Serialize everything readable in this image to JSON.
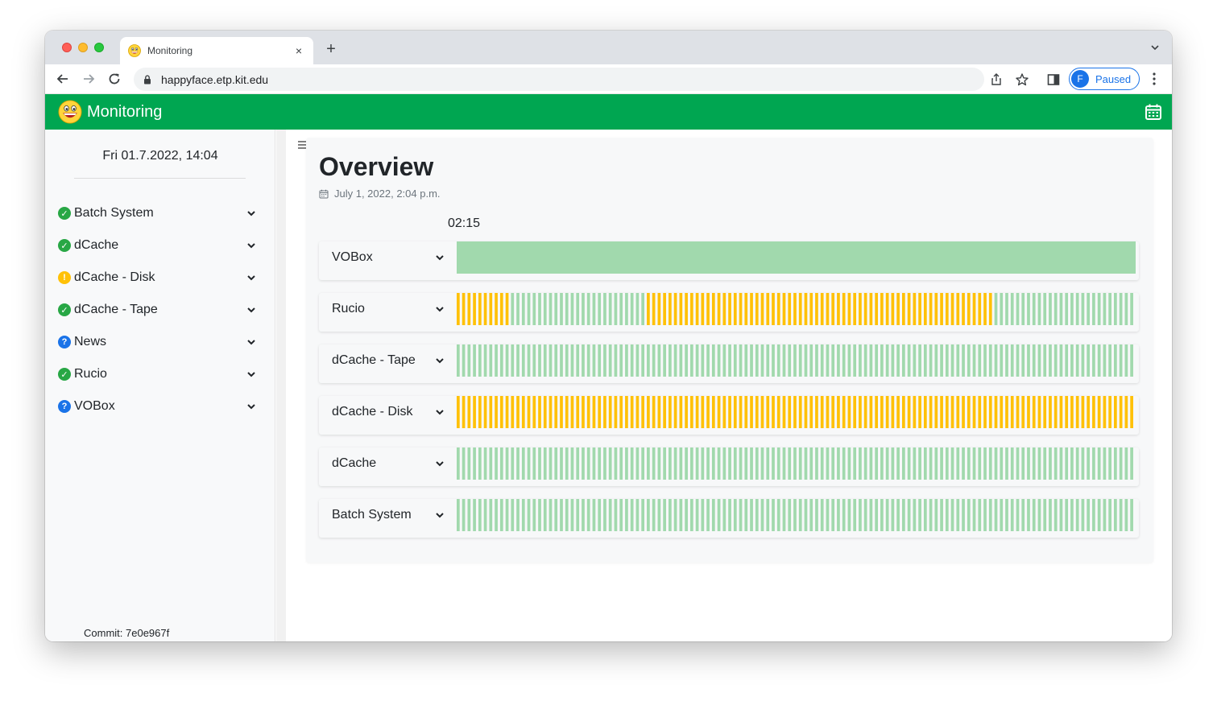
{
  "browser": {
    "tab_title": "Monitoring",
    "tab_close": "×",
    "new_tab": "+",
    "url": "happyface.etp.kit.edu",
    "profile_initial": "F",
    "profile_label": "Paused"
  },
  "navbar": {
    "brand": "Monitoring",
    "logo_icon": "happy-face-icon",
    "right_icon": "calendar-icon",
    "color": "#00a651"
  },
  "sidebar": {
    "date": "Fri 01.7.2022, 14:04",
    "commit": "Commit: 7e0e967f",
    "items": [
      {
        "label": "Batch System",
        "status": "ok"
      },
      {
        "label": "dCache",
        "status": "ok"
      },
      {
        "label": "dCache - Disk",
        "status": "warn"
      },
      {
        "label": "dCache - Tape",
        "status": "ok"
      },
      {
        "label": "News",
        "status": "info"
      },
      {
        "label": "Rucio",
        "status": "ok"
      },
      {
        "label": "VOBox",
        "status": "info"
      }
    ]
  },
  "main": {
    "title": "Overview",
    "date": "July 1, 2022, 2:04 p.m.",
    "time_label": "02:15"
  },
  "status_colors": {
    "ok": "#a1d9ad",
    "warn": "#ffc107",
    "info": "#1a73e8"
  },
  "rows": [
    {
      "label": "VOBox",
      "continuous": true,
      "segments": [
        {
          "status": "ok",
          "count": 1
        }
      ]
    },
    {
      "label": "Rucio",
      "continuous": false,
      "segments": [
        {
          "status": "warn",
          "count": 10
        },
        {
          "status": "ok",
          "count": 25
        },
        {
          "status": "warn",
          "count": 64
        },
        {
          "status": "ok",
          "count": 26
        }
      ]
    },
    {
      "label": "dCache - Tape",
      "continuous": false,
      "segments": [
        {
          "status": "ok",
          "count": 125
        }
      ]
    },
    {
      "label": "dCache - Disk",
      "continuous": false,
      "segments": [
        {
          "status": "warn",
          "count": 125
        }
      ]
    },
    {
      "label": "dCache",
      "continuous": false,
      "segments": [
        {
          "status": "ok",
          "count": 125
        }
      ]
    },
    {
      "label": "Batch System",
      "continuous": false,
      "segments": [
        {
          "status": "ok",
          "count": 125
        }
      ]
    }
  ]
}
